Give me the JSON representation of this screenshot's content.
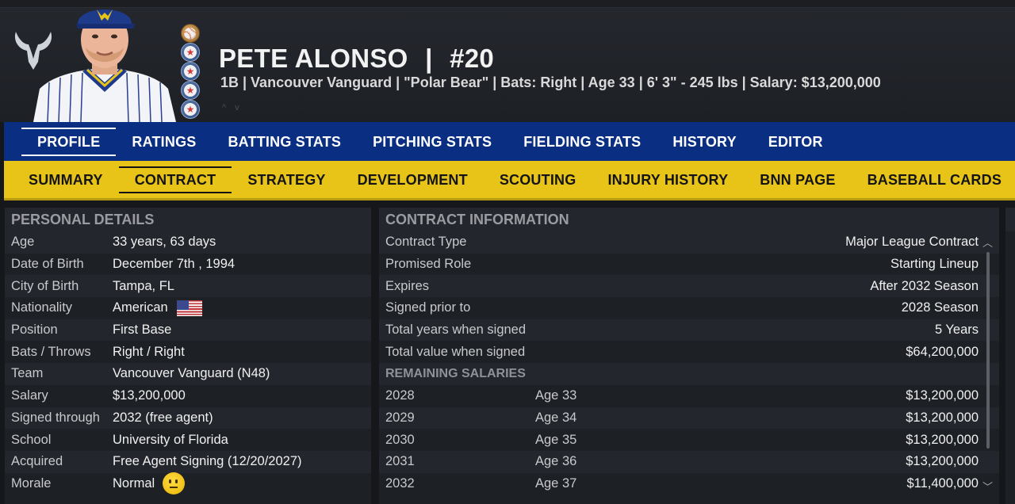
{
  "header": {
    "name": "PETE ALONSO",
    "separator": "|",
    "number": "#20",
    "subtitle": "1B | Vancouver Vanguard  |  \"Polar Bear\" | Bats: Right  |  Age 33  |  6' 3\"  - 245 lbs  |  Salary: $13,200,000",
    "team_logo": "bull-horns-logo",
    "medals": [
      "baseball-medal",
      "star-medal",
      "star-medal",
      "star-medal",
      "star-medal"
    ]
  },
  "main_tabs": [
    "PROFILE",
    "RATINGS",
    "BATTING STATS",
    "PITCHING STATS",
    "FIELDING STATS",
    "HISTORY",
    "EDITOR"
  ],
  "sub_tabs": [
    "SUMMARY",
    "CONTRACT",
    "STRATEGY",
    "DEVELOPMENT",
    "SCOUTING",
    "INJURY HISTORY",
    "BNN PAGE",
    "BASEBALL CARDS"
  ],
  "personal": {
    "title": "PERSONAL DETAILS",
    "rows": [
      {
        "label": "Age",
        "value": "33 years, 63 days"
      },
      {
        "label": "Date of Birth",
        "value": "December 7th , 1994"
      },
      {
        "label": "City of Birth",
        "value": "Tampa, FL"
      },
      {
        "label": "Nationality",
        "value": "American"
      },
      {
        "label": "Position",
        "value": "First Base"
      },
      {
        "label": "Bats / Throws",
        "value": "Right / Right"
      },
      {
        "label": "Team",
        "value": "Vancouver Vanguard (N48)"
      },
      {
        "label": "Salary",
        "value": "$13,200,000"
      },
      {
        "label": "Signed through",
        "value": "2032 (free agent)"
      },
      {
        "label": "School",
        "value": "University of Florida"
      },
      {
        "label": "Acquired",
        "value": "Free Agent Signing (12/20/2027)"
      },
      {
        "label": "Morale",
        "value": "Normal"
      }
    ]
  },
  "contract": {
    "title": "CONTRACT INFORMATION",
    "rows": [
      {
        "label": "Contract Type",
        "value": "Major League Contract"
      },
      {
        "label": "Promised Role",
        "value": "Starting Lineup"
      },
      {
        "label": "Expires",
        "value": "After 2032 Season"
      },
      {
        "label": "Signed prior to",
        "value": "2028 Season"
      },
      {
        "label": "Total years when signed",
        "value": "5 Years"
      },
      {
        "label": "Total value when signed",
        "value": "$64,200,000"
      }
    ],
    "remaining_title": "REMAINING SALARIES",
    "salaries": [
      {
        "year": "2028",
        "age": "Age 33",
        "amount": "$13,200,000"
      },
      {
        "year": "2029",
        "age": "Age 34",
        "amount": "$13,200,000"
      },
      {
        "year": "2030",
        "age": "Age 35",
        "amount": "$13,200,000"
      },
      {
        "year": "2031",
        "age": "Age 36",
        "amount": "$13,200,000"
      },
      {
        "year": "2032",
        "age": "Age 37",
        "amount": "$11,400,000"
      }
    ]
  },
  "colors": {
    "main_tab_bg": "#0a2e82",
    "sub_tab_bg": "#e8c419"
  }
}
